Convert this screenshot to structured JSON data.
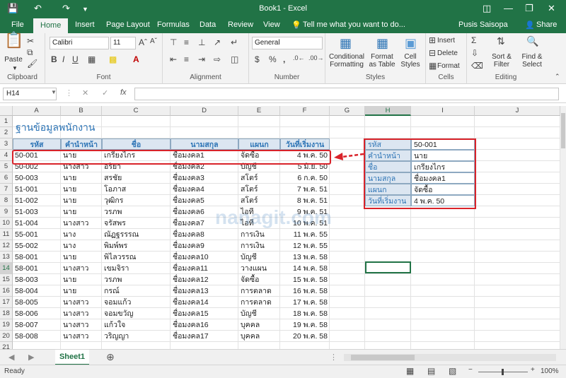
{
  "window": {
    "title": "Book1 - Excel",
    "user": "Pusis Saisopa",
    "share": "Share",
    "tell_me": "Tell me what you want to do..."
  },
  "tabs": [
    "File",
    "Home",
    "Insert",
    "Page Layout",
    "Formulas",
    "Data",
    "Review",
    "View"
  ],
  "ribbon": {
    "clipboard": {
      "label": "Clipboard",
      "paste": "Paste"
    },
    "font": {
      "label": "Font",
      "name": "Calibri",
      "size": "11"
    },
    "alignment": {
      "label": "Alignment"
    },
    "number": {
      "label": "Number",
      "format": "General"
    },
    "styles": {
      "label": "Styles",
      "conditional": "Conditional Formatting",
      "format_table": "Format as Table",
      "cell_styles": "Cell Styles"
    },
    "cells": {
      "label": "Cells",
      "insert": "Insert",
      "delete": "Delete",
      "format": "Format"
    },
    "editing": {
      "label": "Editing",
      "sort": "Sort & Filter",
      "find": "Find & Select"
    }
  },
  "formula_bar": {
    "name_box": "H14",
    "fx": "fx"
  },
  "columns": [
    "A",
    "B",
    "C",
    "D",
    "E",
    "F",
    "G",
    "H",
    "I",
    "J"
  ],
  "rows": [
    "1",
    "2",
    "3",
    "4",
    "5",
    "6",
    "7",
    "8",
    "9",
    "10",
    "11",
    "12",
    "13",
    "14",
    "15",
    "16",
    "17",
    "18",
    "19",
    "20",
    "21"
  ],
  "sheet": {
    "title": "ฐานข้อมูลพนักงาน",
    "headers": [
      "รหัส",
      "คำนำหน้า",
      "ชื่อ",
      "นามสกุล",
      "แผนก",
      "วันที่เริ่มงาน"
    ],
    "data": [
      [
        "50-001",
        "นาย",
        "เกรียงไกร",
        "ชื่อมงคล1",
        "จัดซื้อ",
        "4 พ.ค. 50"
      ],
      [
        "50-002",
        "นางสาว",
        "อริยา",
        "ชื่อมงคล2",
        "บัญชี",
        "5 มิ.ย. 50"
      ],
      [
        "50-003",
        "นาย",
        "สรชัย",
        "ชื่อมงคล3",
        "สโตร์",
        "6 ก.ค. 50"
      ],
      [
        "51-001",
        "นาย",
        "โอภาส",
        "ชื่อมงคล4",
        "สโตร์",
        "7 พ.ค. 51"
      ],
      [
        "51-002",
        "นาย",
        "วุฒิกร",
        "ชื่อมงคล5",
        "สโตร์",
        "8 พ.ค. 51"
      ],
      [
        "51-003",
        "นาย",
        "วรภพ",
        "ชื่อมงคล6",
        "ไอที",
        "9 พ.ค. 51"
      ],
      [
        "51-004",
        "นางสาว",
        "จรัสพร",
        "ชื่อมงคล7",
        "ไอที",
        "10 พ.ค. 51"
      ],
      [
        "55-001",
        "นาง",
        "ณัฏฐรรรณ",
        "ชื่อมงคล8",
        "การเงิน",
        "11 พ.ค. 55"
      ],
      [
        "55-002",
        "นาง",
        "พิมพ์พร",
        "ชื่อมงคล9",
        "การเงิน",
        "12 พ.ค. 55"
      ],
      [
        "58-001",
        "นาย",
        "พิไลวรรณ",
        "ชื่อมงคล10",
        "บัญชี",
        "13 พ.ค. 58"
      ],
      [
        "58-001",
        "นางสาว",
        "เขมจิรา",
        "ชื่อมงคล11",
        "วางแผน",
        "14 พ.ค. 58"
      ],
      [
        "58-003",
        "นาย",
        "วรภพ",
        "ชื่อมงคล12",
        "จัดซื้อ",
        "15 พ.ค. 58"
      ],
      [
        "58-004",
        "นาย",
        "กรณ์",
        "ชื่อมงคล13",
        "การตลาด",
        "16 พ.ค. 58"
      ],
      [
        "58-005",
        "นางสาว",
        "จอมแก้ว",
        "ชื่อมงคล14",
        "การตลาด",
        "17 พ.ค. 58"
      ],
      [
        "58-006",
        "นางสาว",
        "จอมขวัญ",
        "ชื่อมงคล15",
        "บัญชี",
        "18 พ.ค. 58"
      ],
      [
        "58-007",
        "นางสาว",
        "แก้วใจ",
        "ชื่อมงคล16",
        "บุคคล",
        "19 พ.ค. 58"
      ],
      [
        "58-008",
        "นางสาว",
        "วริญญา",
        "ชื่อมงคล17",
        "บุคคล",
        "20 พ.ค. 58"
      ]
    ],
    "lookup": [
      [
        "รหัส",
        "50-001"
      ],
      [
        "คำนำหน้า",
        "นาย"
      ],
      [
        "ชื่อ",
        "เกรียงไกร"
      ],
      [
        "นามสกุล",
        "ชื่อมงคล1"
      ],
      [
        "แผนก",
        "จัดซื้อ"
      ],
      [
        "วันที่เริ่มงาน",
        "4 พ.ค. 50"
      ]
    ]
  },
  "sheet_tab": "Sheet1",
  "status": {
    "ready": "Ready",
    "zoom": "100%"
  },
  "watermark": "nanagit.com",
  "colors": {
    "excel_green": "#217346",
    "header_fill": "#dce6f1",
    "header_text": "#2e75b6",
    "highlight": "#d9232a"
  }
}
